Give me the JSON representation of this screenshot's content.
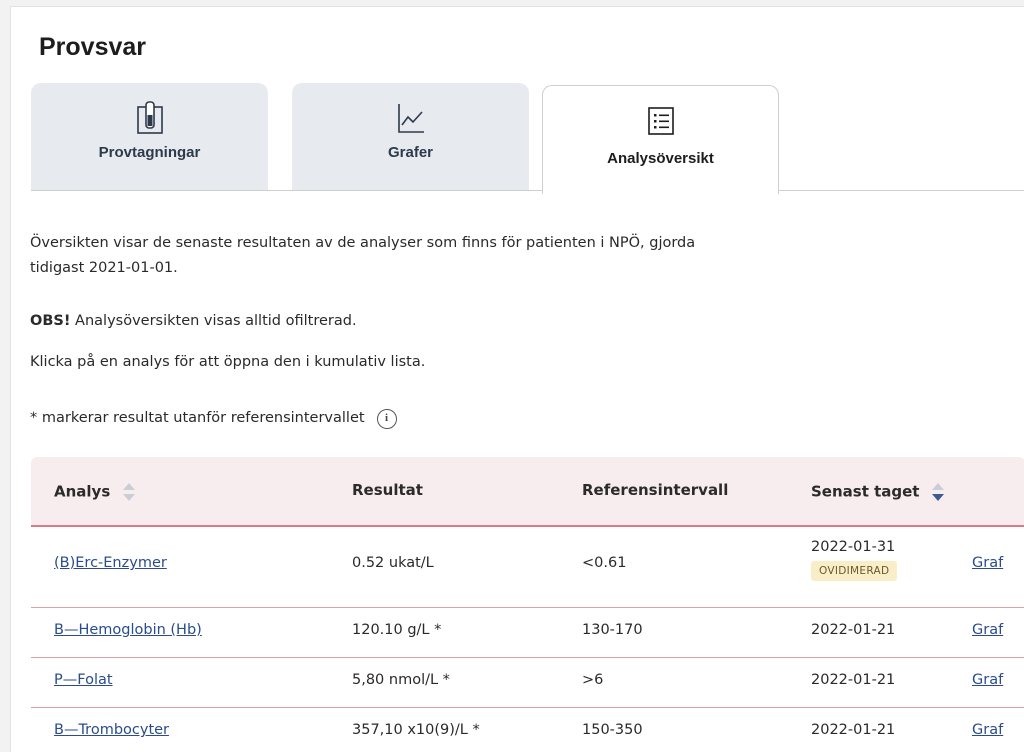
{
  "page_title": "Provsvar",
  "tabs": [
    {
      "label": "Provtagningar",
      "icon": "test-tube-icon",
      "active": false
    },
    {
      "label": "Grafer",
      "icon": "line-chart-icon",
      "active": false
    },
    {
      "label": "Analysöversikt",
      "icon": "list-icon",
      "active": true
    }
  ],
  "info": {
    "intro": "Översikten visar de senaste resultaten av de analyser som finns för patienten i NPÖ, gjorda tidigast 2021-01-01.",
    "obs_bold": "OBS!",
    "obs_text": " Analysöversikten visas alltid ofiltrerad.",
    "click_hint": "Klicka på en analys för att öppna den i kumulativ lista.",
    "marker_note": "* markerar resultat utanför referensintervallet",
    "info_glyph": "i"
  },
  "table": {
    "headers": {
      "analys": "Analys",
      "resultat": "Resultat",
      "referens": "Referensintervall",
      "senast": "Senast taget"
    },
    "rows": [
      {
        "analys": "(B)Erc-Enzymer",
        "resultat": "0.52 ukat/L",
        "referens": "<0.61",
        "datum": "2022-01-31",
        "badge": "OVIDIMERAD",
        "graf": "Graf"
      },
      {
        "analys": "B—Hemoglobin (Hb)",
        "resultat": "120.10 g/L *",
        "referens": "130-170",
        "datum": "2022-01-21",
        "badge": "",
        "graf": "Graf"
      },
      {
        "analys": "P—Folat",
        "resultat": "5,80 nmol/L *",
        "referens": ">6",
        "datum": "2022-01-21",
        "badge": "",
        "graf": "Graf"
      },
      {
        "analys": "B—Trombocyter",
        "resultat": "357,10 x10(9)/L *",
        "referens": "150-350",
        "datum": "2022-01-21",
        "badge": "",
        "graf": "Graf"
      }
    ]
  },
  "colors": {
    "header_bg": "#f8edee",
    "row_border": "#d9a2ab",
    "link": "#2a4c8c",
    "badge_bg": "#f9eec8",
    "sort_active": "#3b5b92",
    "sort_inactive": "#c9ced6"
  }
}
